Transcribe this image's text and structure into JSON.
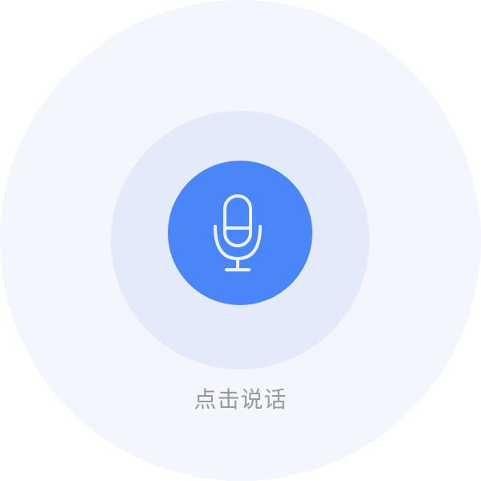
{
  "colors": {
    "outer_ring": "#f3f6fc",
    "middle_ring": "#e3eaf9",
    "button": "#4a86f8",
    "icon_stroke": "#eaf1ff",
    "label_text": "#9a9a9a"
  },
  "voice_input": {
    "button_icon": "microphone-icon",
    "label": "点击说话"
  }
}
